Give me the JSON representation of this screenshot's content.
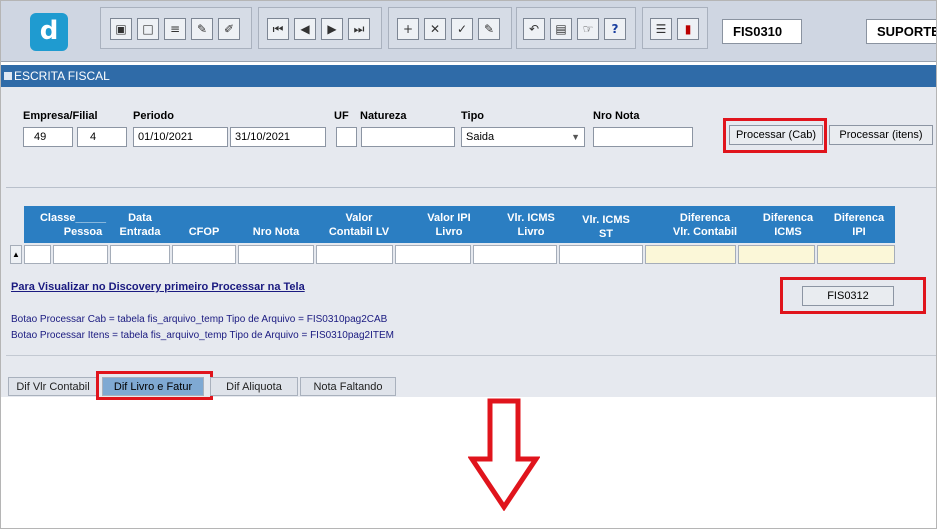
{
  "toolbar": {
    "logo_letter": "d",
    "icons": [
      "save-icon",
      "maximize-icon",
      "print-icon",
      "query-icon",
      "edit-icon",
      "first-record-icon",
      "previous-record-icon",
      "next-record-icon",
      "last-record-icon",
      "insert-record-icon",
      "delete-record-icon",
      "save-record-icon",
      "cancel-icon",
      "undo-icon",
      "clipboard-icon",
      "help-icon",
      "question-icon",
      "menu-icon",
      "exit-icon"
    ],
    "form_code": "FIS0310",
    "user": "SUPORTE"
  },
  "window": {
    "title": "ESCRITA FISCAL"
  },
  "filters": {
    "empresa_filial_label": "Empresa/Filial",
    "empresa": "49",
    "filial": "4",
    "periodo_label": "Periodo",
    "periodo_inicio": "01/10/2021",
    "periodo_fim": "31/10/2021",
    "uf_label": "UF",
    "uf": "",
    "natureza_label": "Natureza",
    "natureza": "",
    "tipo_label": "Tipo",
    "tipo": "Saida",
    "nro_nota_label": "Nro  Nota",
    "nro_nota": ""
  },
  "buttons": {
    "processar_cab": "Processar (Cab)",
    "processar_itens": "Processar (itens)",
    "fis0312": "FIS0312"
  },
  "grid": {
    "headers": [
      [
        "Classe_____",
        "Pessoa"
      ],
      [
        "Data",
        "Entrada"
      ],
      [
        "",
        "CFOP"
      ],
      [
        "",
        "Nro Nota"
      ],
      [
        "Valor",
        "Contabil LV"
      ],
      [
        "Valor IPI",
        "Livro"
      ],
      [
        "Vlr. ICMS",
        "Livro"
      ],
      [
        "Vlr. ICMS",
        "ST"
      ],
      [
        "Diferenca",
        "Vlr. Contabil"
      ],
      [
        "Diferenca",
        "ICMS"
      ],
      [
        "Diferenca",
        "IPI"
      ]
    ]
  },
  "messages": {
    "link": "Para Visualizar no Discovery primeiro Processar na  Tela ",
    "info_cab": "Botao  Processar Cab =  tabela fis_arquivo_temp Tipo de Arquivo = FIS0310pag2CAB",
    "info_itens": "Botao Processar Itens = tabela fis_arquivo_temp Tipo de Arquivo = FIS0310pag2ITEM"
  },
  "tabs": [
    "Dif Vlr Contabil",
    "Dif Livro e Fatur",
    "Dif Aliquota",
    "Nota Faltando"
  ],
  "colors": {
    "accent": "#2f6ba8",
    "header": "#2b7ec2",
    "highlight": "#e0141c"
  }
}
